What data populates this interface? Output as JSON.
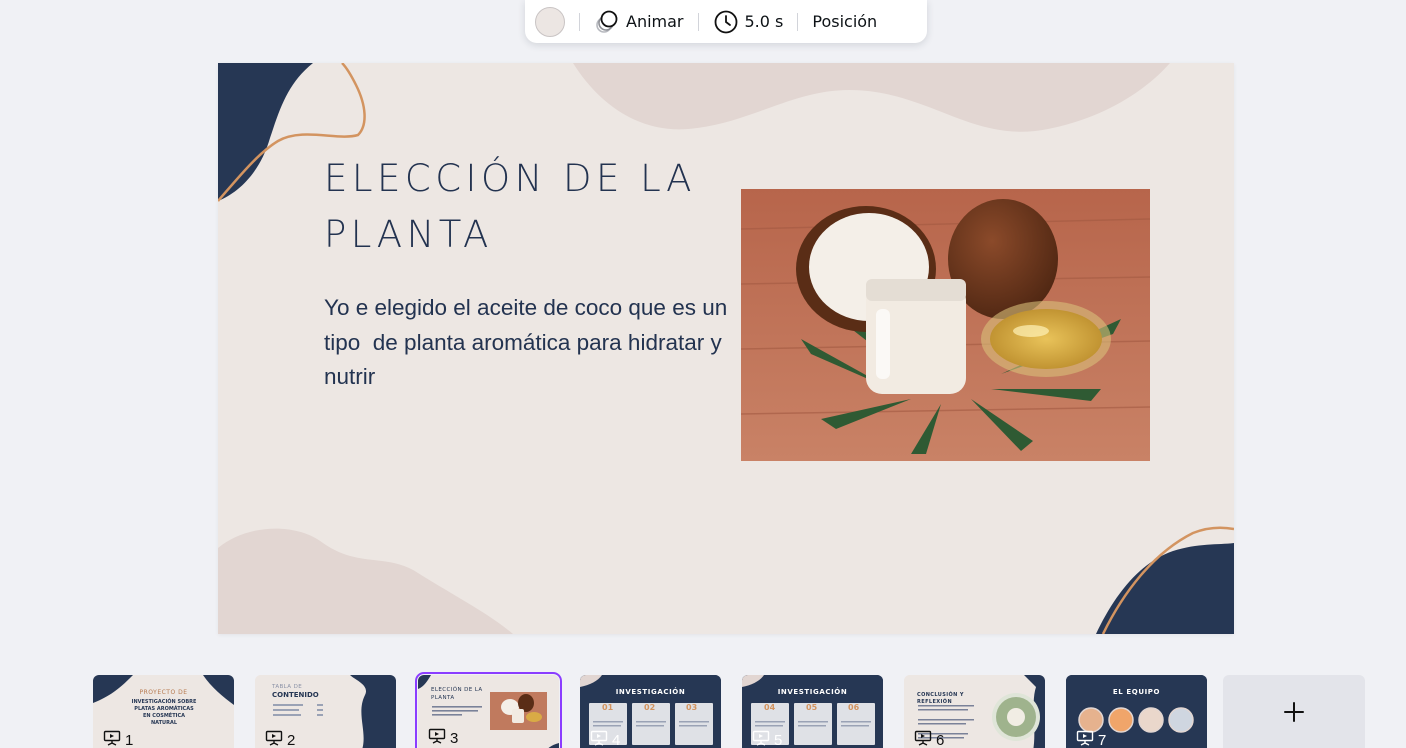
{
  "toolbar": {
    "color_swatch": "#ece6e3",
    "animate_label": "Animar",
    "duration_label": "5.0 s",
    "position_label": "Posición"
  },
  "slide": {
    "title": "ELECCIÓN DE LA PLANTA",
    "body": "Yo e elegido el aceite de coco que es un  tipo  de planta aromática para hidratar y nutrir",
    "photo": "coconut-oil-photo",
    "colors": {
      "background": "#ede7e3",
      "navy": "#263754",
      "orange_line": "#d39460",
      "blob": "#e2d6d2",
      "text": "#233350"
    }
  },
  "thumbnails": [
    {
      "number": "1",
      "heading": "PROYECTO DE",
      "title": "INVESTIGACIÓN SOBRE PLATAS AROMÁTICAS EN COSMÉTICA NATURAL"
    },
    {
      "number": "2",
      "heading": "TABLA DE",
      "title": "CONTENIDO"
    },
    {
      "number": "3",
      "heading": "ELECCIÓN DE LA",
      "title": "PLANTA",
      "selected": true
    },
    {
      "number": "4",
      "title": "INVESTIGACIÓN",
      "cols": [
        "01",
        "02",
        "03"
      ]
    },
    {
      "number": "5",
      "title": "INVESTIGACIÓN",
      "cols": [
        "04",
        "05",
        "06"
      ]
    },
    {
      "number": "6",
      "heading": "CONCLUSIÓN Y",
      "title": "REFLEXIÓN"
    },
    {
      "number": "7",
      "title": "EL EQUIPO"
    }
  ],
  "add_slide_icon": "plus-icon"
}
